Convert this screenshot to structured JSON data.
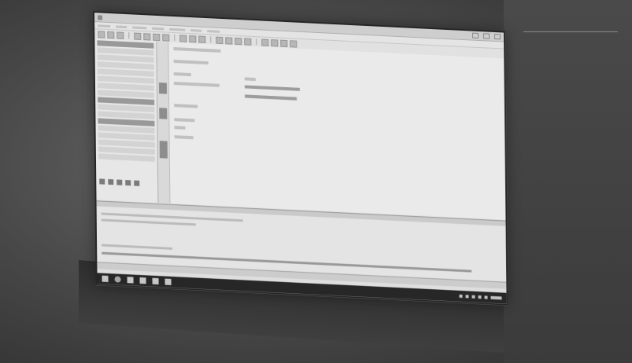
{
  "scene": {
    "description_free": true
  },
  "window": {
    "title_text": "",
    "controls": [
      "minimize",
      "maximize",
      "close"
    ]
  },
  "menubar": {
    "items": []
  },
  "toolbar": {
    "button_count": 22
  },
  "icons": {
    "minimize": "minimize-icon",
    "maximize": "maximize-icon",
    "close": "close-icon",
    "start": "windows-start-icon",
    "search": "search-icon",
    "task_view": "task-view-icon"
  },
  "colors": {
    "screen_bg": "#e9e9e9",
    "taskbar": "#1d1d1d",
    "panel": "#f2f2f2"
  }
}
